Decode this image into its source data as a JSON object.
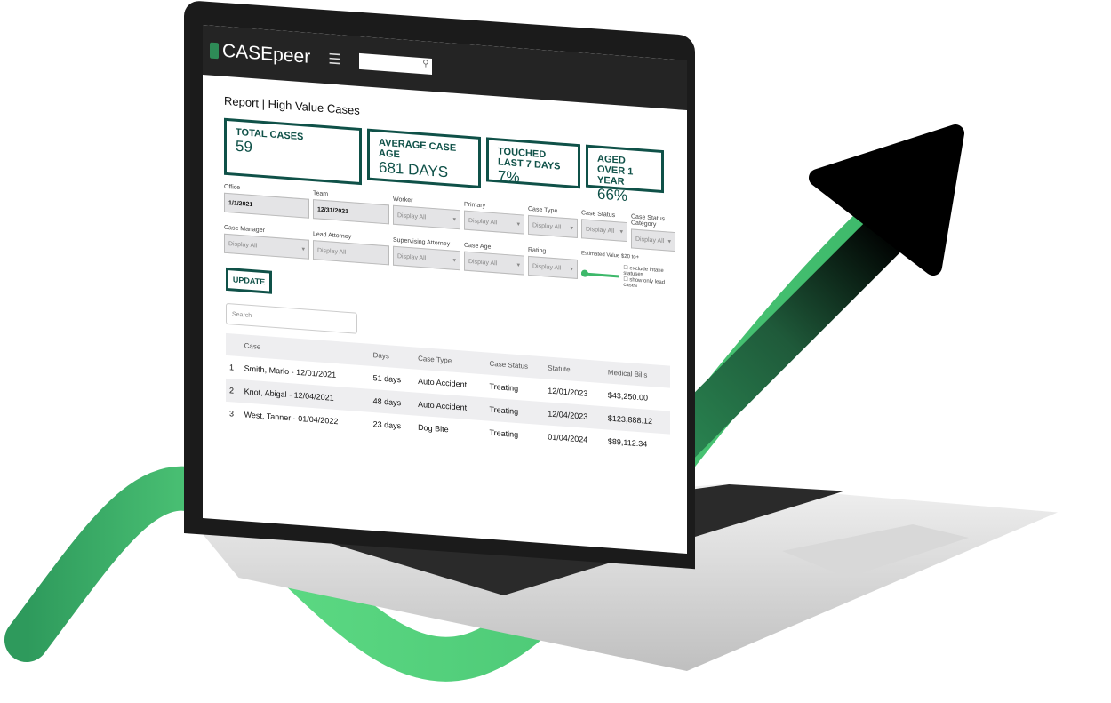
{
  "app": {
    "logo": "CASEpeer",
    "menu_icon": "hamburger-icon",
    "search_icon": "search-icon"
  },
  "page_title": "Report | High Value Cases",
  "kpis": [
    {
      "label": "TOTAL CASES",
      "value": "59"
    },
    {
      "label": "AVERAGE CASE AGE",
      "value": "681 DAYS"
    },
    {
      "label": "TOUCHED LAST 7 DAYS",
      "value": "7%"
    },
    {
      "label": "AGED OVER 1 YEAR",
      "value": "66%"
    }
  ],
  "filters": {
    "office": {
      "label": "Office",
      "value": "1/1/2021"
    },
    "team": {
      "label": "Team",
      "value": "12/31/2021"
    },
    "worker": {
      "label": "Worker",
      "value": "Display All"
    },
    "primary": {
      "label": "Primary",
      "value": "Display All"
    },
    "case_type": {
      "label": "Case Type",
      "value": "Display All"
    },
    "case_status": {
      "label": "Case Status",
      "value": "Display All"
    },
    "case_status_category": {
      "label": "Case Status Category",
      "value": "Display All"
    },
    "case_manager": {
      "label": "Case Manager",
      "value": "Display All"
    },
    "lead_attorney": {
      "label": "Lead Attorney",
      "value": "Display All"
    },
    "supervising_attorney": {
      "label": "Supervising Attorney",
      "value": "Display All"
    },
    "case_age": {
      "label": "Case Age",
      "value": "Display All"
    },
    "rating": {
      "label": "Rating",
      "value": "Display All"
    },
    "estimated_value": {
      "label": "Estimated Value $20 to+"
    },
    "checkbox1": "exclude intake statuses",
    "checkbox2": "show only lead cases"
  },
  "update_label": "UPDATE",
  "search_placeholder": "Search",
  "table": {
    "headers": [
      "",
      "Case",
      "Days",
      "Case Type",
      "Case Status",
      "Statute",
      "Medical Bills"
    ],
    "rows": [
      [
        "1",
        "Smith, Marlo - 12/01/2021",
        "51 days",
        "Auto Accident",
        "Treating",
        "12/01/2023",
        "$43,250.00"
      ],
      [
        "2",
        "Knot, Abigal - 12/04/2021",
        "48 days",
        "Auto Accident",
        "Treating",
        "12/04/2023",
        "$123,888.12"
      ],
      [
        "3",
        "West, Tanner - 01/04/2022",
        "23 days",
        "Dog Bite",
        "Treating",
        "01/04/2024",
        "$89,112.34"
      ]
    ]
  },
  "colors": {
    "brand": "#0f5148",
    "swoosh": "#4cc97a",
    "arrow": "#000000"
  }
}
